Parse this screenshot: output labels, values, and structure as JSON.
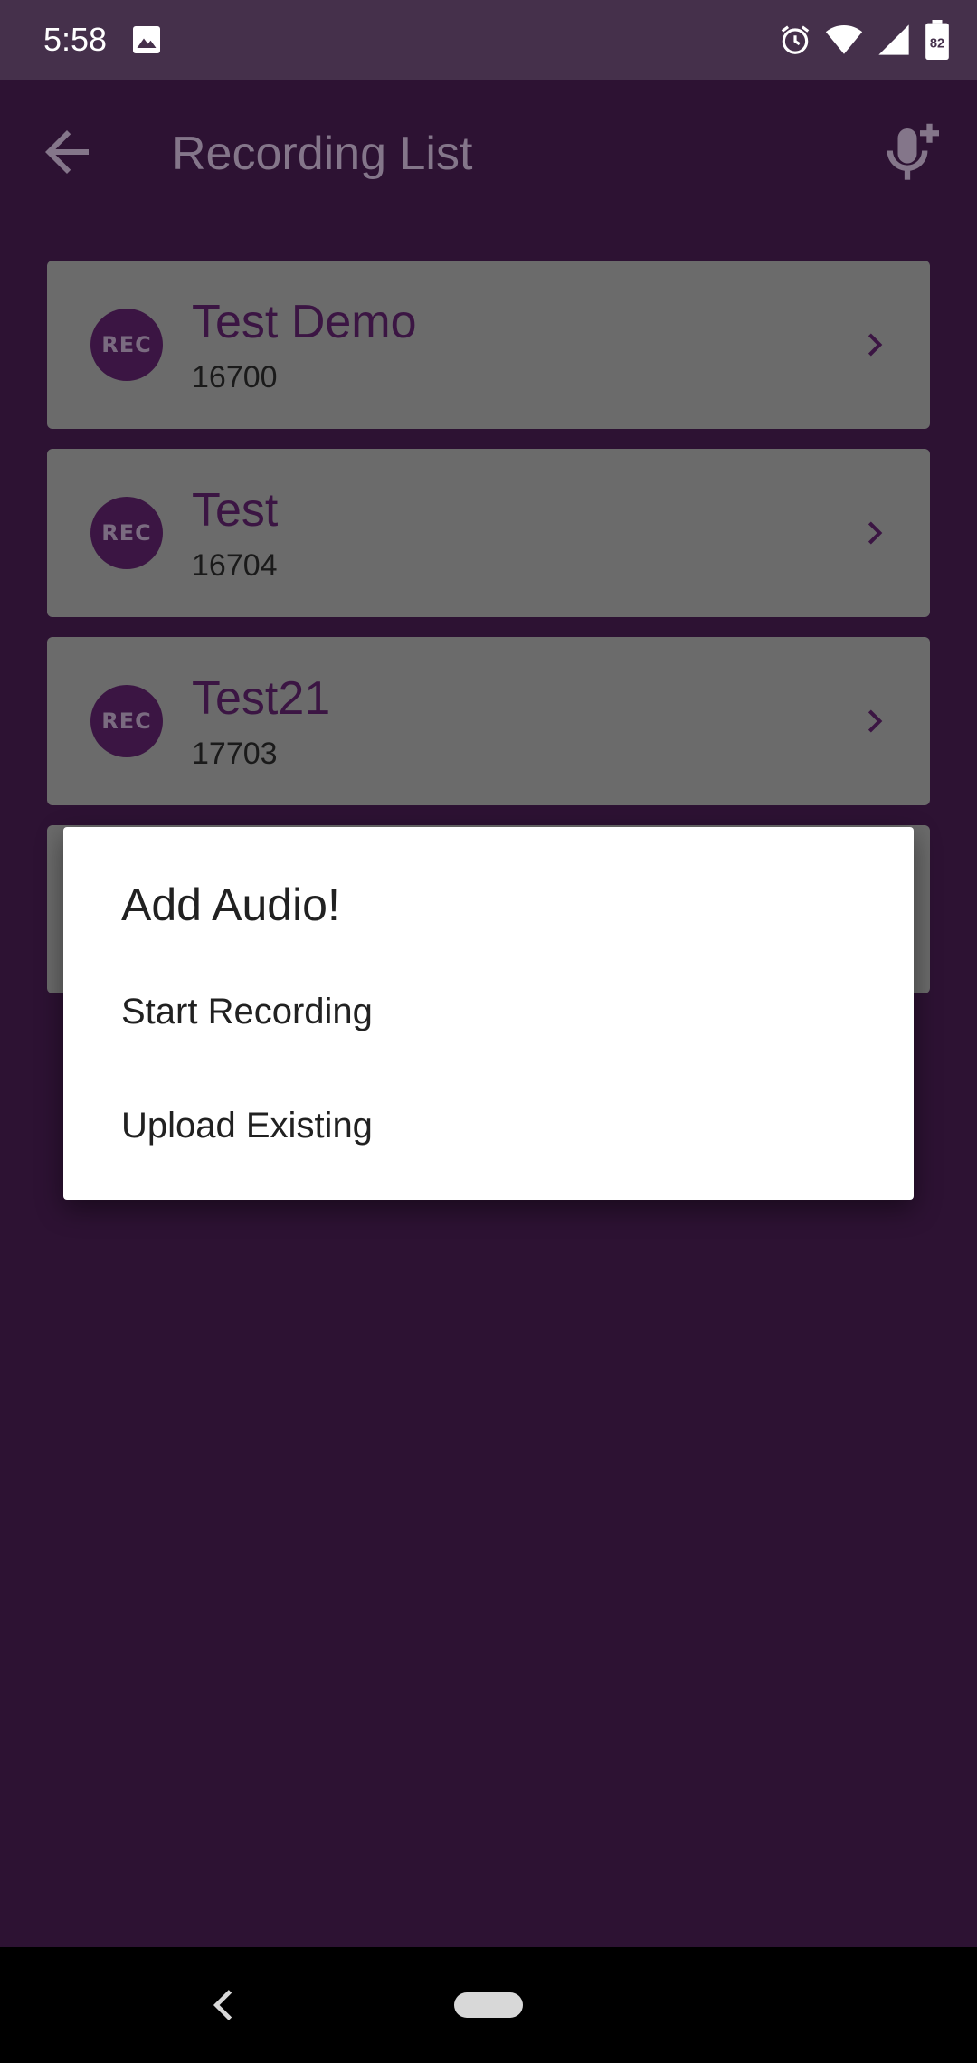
{
  "status_bar": {
    "time": "5:58",
    "battery": "82"
  },
  "app_bar": {
    "title": "Recording List"
  },
  "recordings": [
    {
      "badge": "REC",
      "title": "Test Demo",
      "subtitle": "16700"
    },
    {
      "badge": "REC",
      "title": "Test",
      "subtitle": "16704"
    },
    {
      "badge": "REC",
      "title": "Test21",
      "subtitle": "17703"
    }
  ],
  "dialog": {
    "title": "Add Audio!",
    "options": [
      "Start Recording",
      "Upload Existing"
    ]
  },
  "colors": {
    "background": "#2d1233",
    "status_bar": "#45304b",
    "card": "#6b6b6b",
    "accent": "#3b1543",
    "title_dim": "#84768a"
  },
  "icons": {
    "back": "arrow-left-icon",
    "mic_add": "mic-add-icon",
    "chevron": "chevron-right-icon",
    "status_image": "image-icon",
    "alarm": "alarm-icon",
    "wifi": "wifi-icon",
    "signal": "signal-icon",
    "battery": "battery-icon"
  }
}
